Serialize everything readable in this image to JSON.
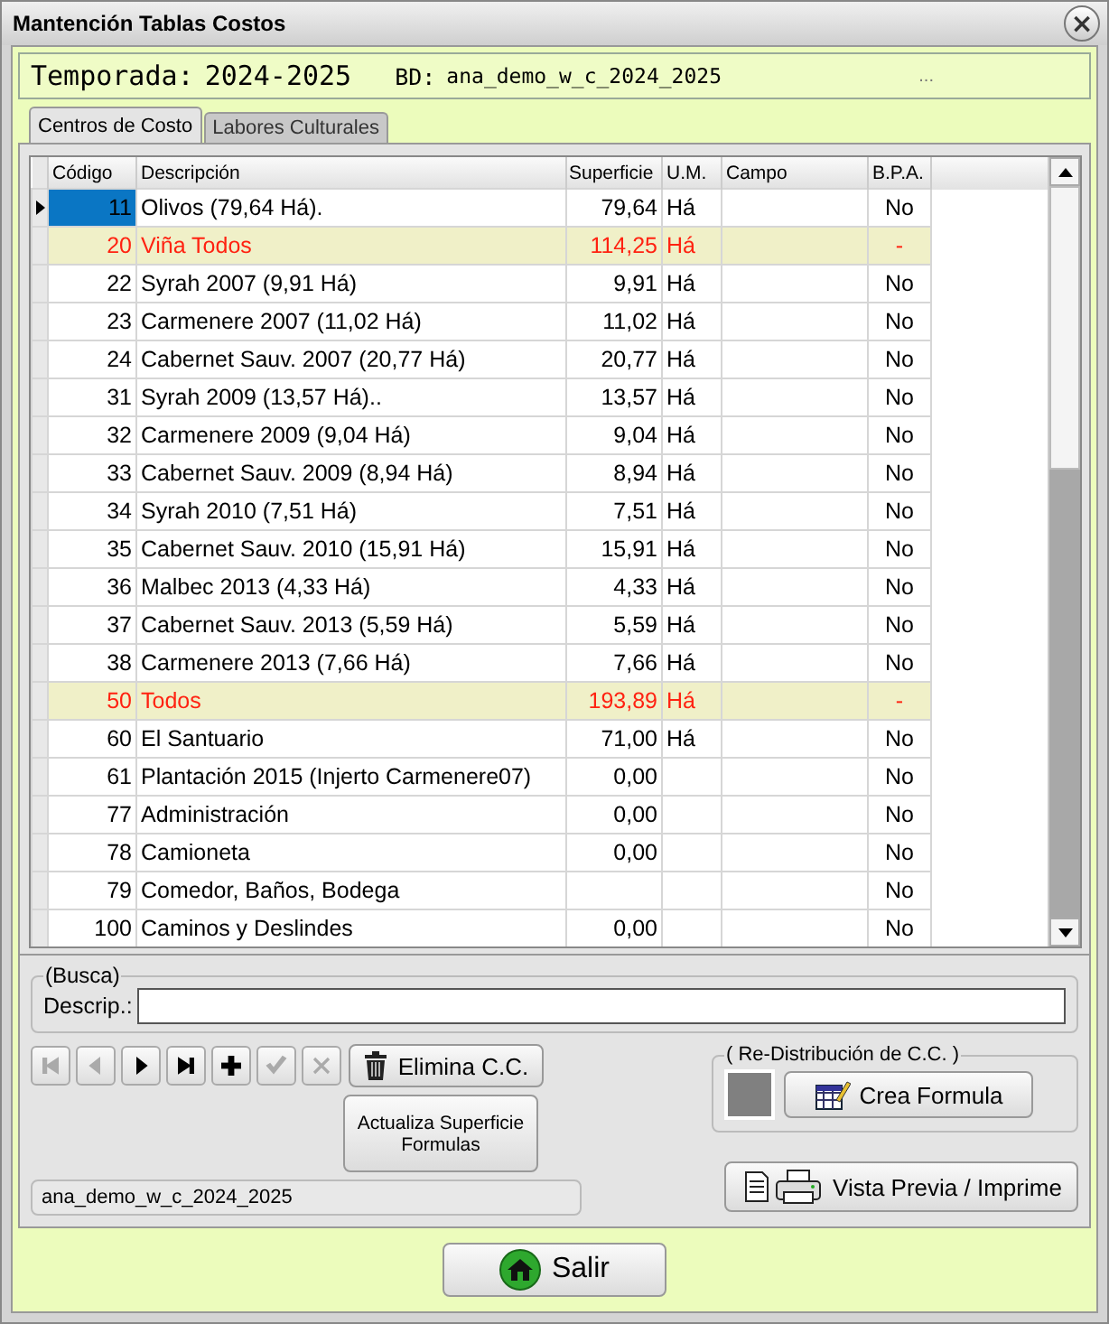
{
  "window": {
    "title": "Mantención Tablas Costos",
    "close": "×"
  },
  "header": {
    "season_label": "Temporada:",
    "season": "2024-2025",
    "db_label": "BD:",
    "db": "ana_demo_w_c_2024_2025",
    "ellipsis": "..."
  },
  "tabs": [
    {
      "label": "Centros de Costo",
      "selected": true
    },
    {
      "label": "Labores Culturales",
      "selected": false
    }
  ],
  "table": {
    "columns": [
      "Código",
      "Descripción",
      "Superficie",
      "U.M.",
      "Campo",
      "B.P.A."
    ],
    "rows": [
      {
        "kind": "item",
        "selected": true,
        "cells": [
          "11",
          "Olivos  (79,64 Há).",
          "79,64",
          "Há",
          "",
          "No"
        ]
      },
      {
        "kind": "total",
        "selected": false,
        "cells": [
          "20",
          "Viña Todos",
          "114,25",
          "Há",
          "",
          "-"
        ]
      },
      {
        "kind": "item",
        "selected": false,
        "cells": [
          "22",
          "Syrah 2007 (9,91 Há)",
          "9,91",
          "Há",
          "",
          "No"
        ]
      },
      {
        "kind": "item",
        "selected": false,
        "cells": [
          "23",
          "Carmenere 2007 (11,02 Há)",
          "11,02",
          "Há",
          "",
          "No"
        ]
      },
      {
        "kind": "item",
        "selected": false,
        "cells": [
          "24",
          "Cabernet Sauv. 2007 (20,77 Há)",
          "20,77",
          "Há",
          "",
          "No"
        ]
      },
      {
        "kind": "item",
        "selected": false,
        "cells": [
          "31",
          "Syrah 2009 (13,57 Há)..",
          "13,57",
          "Há",
          "",
          "No"
        ]
      },
      {
        "kind": "item",
        "selected": false,
        "cells": [
          "32",
          "Carmenere 2009 (9,04 Há)",
          "9,04",
          "Há",
          "",
          "No"
        ]
      },
      {
        "kind": "item",
        "selected": false,
        "cells": [
          "33",
          "Cabernet Sauv. 2009 (8,94 Há)",
          "8,94",
          "Há",
          "",
          "No"
        ]
      },
      {
        "kind": "item",
        "selected": false,
        "cells": [
          "34",
          "Syrah 2010 (7,51 Há)",
          "7,51",
          "Há",
          "",
          "No"
        ]
      },
      {
        "kind": "item",
        "selected": false,
        "cells": [
          "35",
          "Cabernet Sauv. 2010 (15,91 Há)",
          "15,91",
          "Há",
          "",
          "No"
        ]
      },
      {
        "kind": "item",
        "selected": false,
        "cells": [
          "36",
          "Malbec 2013 (4,33 Há)",
          "4,33",
          "Há",
          "",
          "No"
        ]
      },
      {
        "kind": "item",
        "selected": false,
        "cells": [
          "37",
          "Cabernet Sauv. 2013 (5,59 Há)",
          "5,59",
          "Há",
          "",
          "No"
        ]
      },
      {
        "kind": "item",
        "selected": false,
        "cells": [
          "38",
          "Carmenere 2013 (7,66 Há)",
          "7,66",
          "Há",
          "",
          "No"
        ]
      },
      {
        "kind": "total",
        "selected": false,
        "cells": [
          "50",
          "Todos",
          "193,89",
          "Há",
          "",
          "-"
        ]
      },
      {
        "kind": "item",
        "selected": false,
        "cells": [
          "60",
          "El Santuario",
          "71,00",
          "Há",
          "",
          "No"
        ]
      },
      {
        "kind": "item",
        "selected": false,
        "cells": [
          "61",
          "Plantación 2015 (Injerto Carmenere07)",
          "0,00",
          "",
          "",
          "No"
        ]
      },
      {
        "kind": "item",
        "selected": false,
        "cells": [
          "77",
          "Administración",
          "0,00",
          "",
          "",
          "No"
        ]
      },
      {
        "kind": "item",
        "selected": false,
        "cells": [
          "78",
          "Camioneta",
          "0,00",
          "",
          "",
          "No"
        ]
      },
      {
        "kind": "item",
        "selected": false,
        "cells": [
          "79",
          "Comedor, Baños, Bodega",
          "",
          "",
          "",
          "No"
        ]
      },
      {
        "kind": "item",
        "selected": false,
        "cells": [
          "100",
          "Caminos y Deslindes",
          "0,00",
          "",
          "",
          "No"
        ]
      }
    ]
  },
  "search": {
    "group": "(Busca)",
    "label": "Descrip.:"
  },
  "nav_buttons": [
    {
      "kind": "first",
      "disabled": true
    },
    {
      "kind": "prev",
      "disabled": true
    },
    {
      "kind": "next",
      "disabled": false
    },
    {
      "kind": "last",
      "disabled": false
    },
    {
      "kind": "add",
      "disabled": false
    },
    {
      "kind": "confirm",
      "disabled": true
    },
    {
      "kind": "cancel",
      "disabled": true
    }
  ],
  "delete_button": "Elimina C.C.",
  "update_button": [
    "Actualiza  Superficie",
    "Formulas"
  ],
  "status": "ana_demo_w_c_2024_2025",
  "redistribution": {
    "group": "( Re-Distribución de C.C. )",
    "button": "Crea Formula"
  },
  "print_button": "Vista Previa / Imprime",
  "exit_button": "Salir"
}
